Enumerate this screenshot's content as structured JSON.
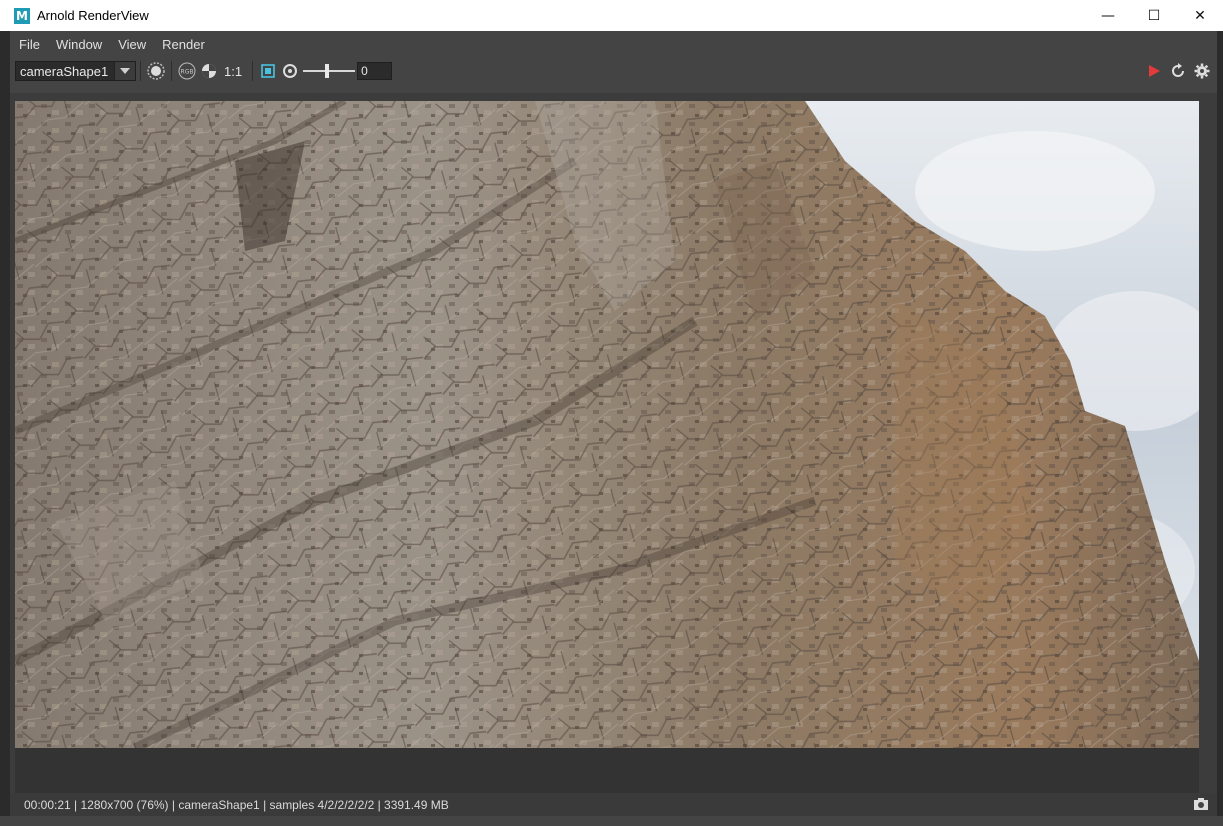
{
  "window": {
    "title": "Arnold RenderView",
    "logo_letter": "M",
    "controls": {
      "minimize": "—",
      "maximize": "☐",
      "close": "✕"
    }
  },
  "menu": [
    "File",
    "Window",
    "View",
    "Render"
  ],
  "toolbar": {
    "camera": "cameraShape1",
    "ratio": "1:1",
    "exposure_value": "0",
    "icons": [
      "region-icon",
      "rgb-icon",
      "channel-icon",
      "crop-icon",
      "snapshot-icon"
    ],
    "right_icons": [
      "render-play-icon",
      "refresh-icon",
      "gear-icon"
    ]
  },
  "status": {
    "text": "00:00:21 | 1280x700 (76%) | cameraShape1  | samples 4/2/2/2/2/2 | 3391.49 MB"
  },
  "colors": {
    "title_bg": "#ffffff",
    "window_bg": "#444444",
    "render_play": "#e33b3b",
    "sky": "#c9d2dc"
  }
}
